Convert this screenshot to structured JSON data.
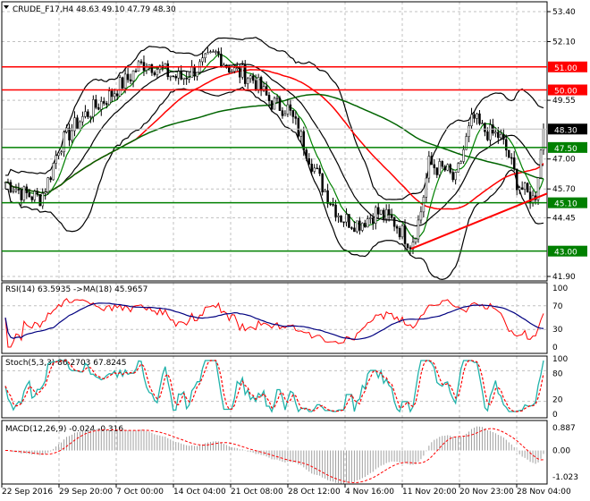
{
  "header": {
    "symbol_line": "CRUDE_F17,H4  48.63 49.10 47.79 48.30"
  },
  "indicators": {
    "rsi_label": "RSI(14) 63.5935  ->MA(18) 45.9657",
    "stoch_label": "Stoch(5,3,3) 86.2703 67.8245",
    "macd_label": "MACD(12,26,9) -0.024 -0.316"
  },
  "colors": {
    "up": "#000000",
    "red": "#ff0000",
    "green": "#008000",
    "band": "#000000",
    "rsi_ma": "#000080",
    "stoch_main": "#20b2aa"
  },
  "chart_data": {
    "type": "line",
    "title": "CRUDE_F17,H4",
    "ohlc_last": {
      "open": 48.63,
      "high": 49.1,
      "low": 47.79,
      "close": 48.3
    },
    "ylim": [
      41.9,
      53.4
    ],
    "y_ticks": [
      "53.40",
      "52.10",
      "49.55",
      "47.00",
      "45.70",
      "44.45",
      "41.90"
    ],
    "x_ticks": [
      "22 Sep 2016",
      "29 Sep 20:00",
      "7 Oct 00:00",
      "14 Oct 04:00",
      "21 Oct 08:00",
      "28 Oct 12:00",
      "4 Nov 16:00",
      "11 Nov 20:00",
      "20 Nov 23:00",
      "28 Nov 04:00"
    ],
    "closes": [
      46,
      45.8,
      45.5,
      45.4,
      45.3,
      46.2,
      47.5,
      48,
      48.5,
      48.9,
      49.2,
      49.5,
      49.8,
      50.2,
      50.5,
      51,
      51.2,
      51,
      50.8,
      50.6,
      50.5,
      50.8,
      51,
      51.3,
      51.6,
      51.1,
      50.8,
      50.7,
      50.5,
      50,
      49.5,
      49.3,
      49.2,
      48.4,
      47.5,
      46.6,
      45.8,
      45.1,
      44.5,
      44.3,
      44.2,
      44.4,
      44.7,
      44.5,
      44.3,
      43.8,
      43.3,
      44.5,
      46.8,
      46.6,
      46.5,
      46,
      47.5,
      48.8,
      48.3,
      48.1,
      48,
      47.2,
      46,
      45.5,
      45.2,
      48.3
    ],
    "horizontal_levels": [
      {
        "label": "51.00",
        "value": 51.0,
        "color": "#ff0000"
      },
      {
        "label": "50.00",
        "value": 50.0,
        "color": "#ff0000"
      },
      {
        "label": "47.50",
        "value": 47.5,
        "color": "#008000"
      },
      {
        "label": "45.10",
        "value": 45.1,
        "color": "#008000"
      },
      {
        "label": "43.00",
        "value": 43.0,
        "color": "#008000"
      }
    ],
    "current_price": {
      "label": "48.30",
      "value": 48.3
    },
    "trendline": {
      "from": 43.1,
      "to": 45.5,
      "color": "#ff0000"
    },
    "rsi": {
      "ticks": [
        "100",
        "70",
        "30",
        "0"
      ],
      "levels": [
        100,
        70,
        30,
        0
      ]
    },
    "stoch": {
      "ticks": [
        "100",
        "80",
        "20",
        "0"
      ],
      "levels": [
        100,
        80,
        20,
        0
      ]
    },
    "macd": {
      "ticks": [
        "0.887",
        "0.00",
        "-1.023"
      ],
      "levels": [
        0.887,
        0,
        -1.023
      ]
    }
  }
}
